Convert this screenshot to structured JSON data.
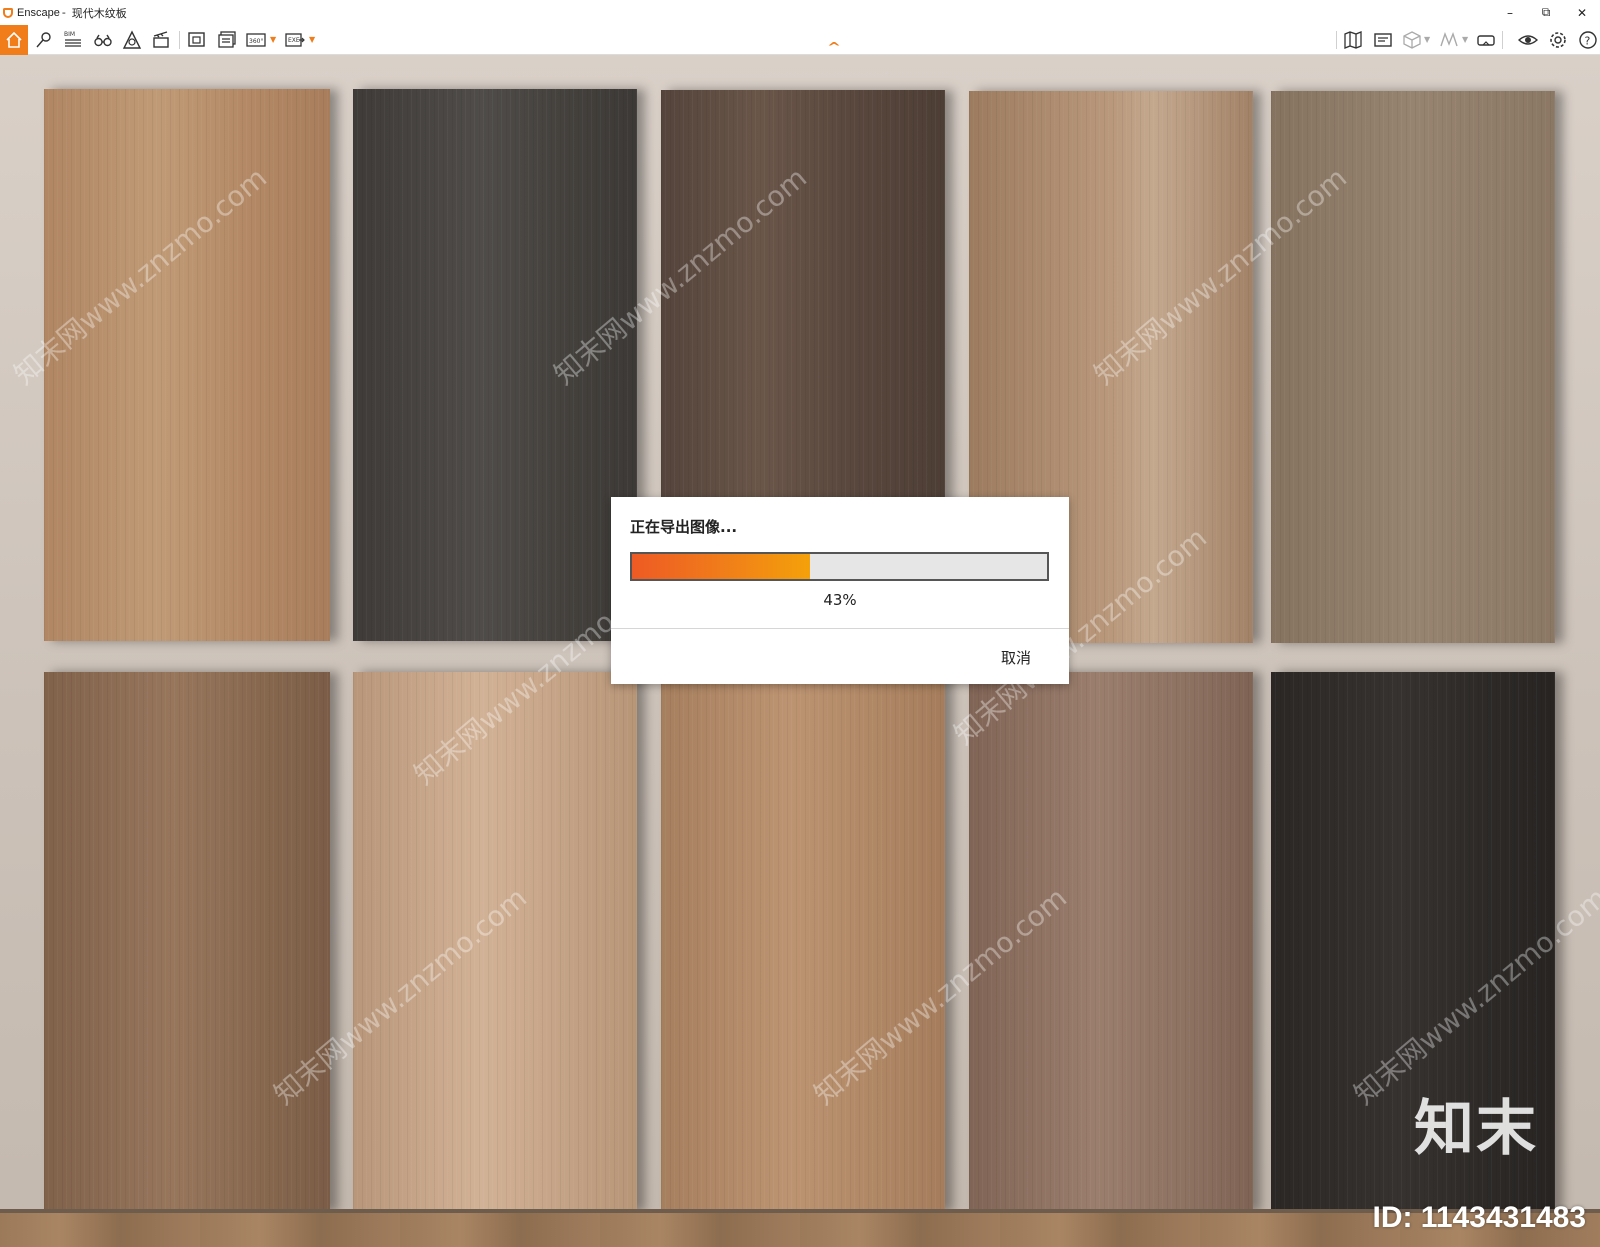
{
  "window": {
    "app_name": "Enscape",
    "separator": "-",
    "document_title": "现代木纹板",
    "minimize": "–",
    "restore": "⧉",
    "close": "✕"
  },
  "toolbar": {
    "left_icons": [
      "home-icon",
      "pin-icon",
      "bim-icon",
      "binoculars-icon",
      "atlas-icon",
      "clapperboard-icon",
      "screenshot-icon",
      "batch-render-icon",
      "panorama-360-icon",
      "export-exe-icon"
    ],
    "right_icons": [
      "map-icon",
      "sketch-icon",
      "cube-icon",
      "section-icon",
      "vr-headset-icon",
      "eye-icon",
      "gear-icon",
      "help-icon"
    ],
    "bim_label": "BIM",
    "panorama_label": "360°",
    "exe_label": "EXE",
    "help_label": "?",
    "accent_color": "#f07c1a"
  },
  "dialog": {
    "title": "正在导出图像...",
    "progress_percent": 43,
    "progress_text": "43%",
    "cancel_label": "取消"
  },
  "scene": {
    "watermark_text": "知末网www.znzmo.com",
    "brand_mark": "知末",
    "id_label": "ID: 1143431483",
    "panel_colors": [
      "#b48a66",
      "#494643",
      "#5c4a40",
      "#a9886b",
      "#8d7a65",
      "#8a6a53",
      "#c3a186",
      "#b08866",
      "#8e7262",
      "#2d2a28"
    ]
  }
}
